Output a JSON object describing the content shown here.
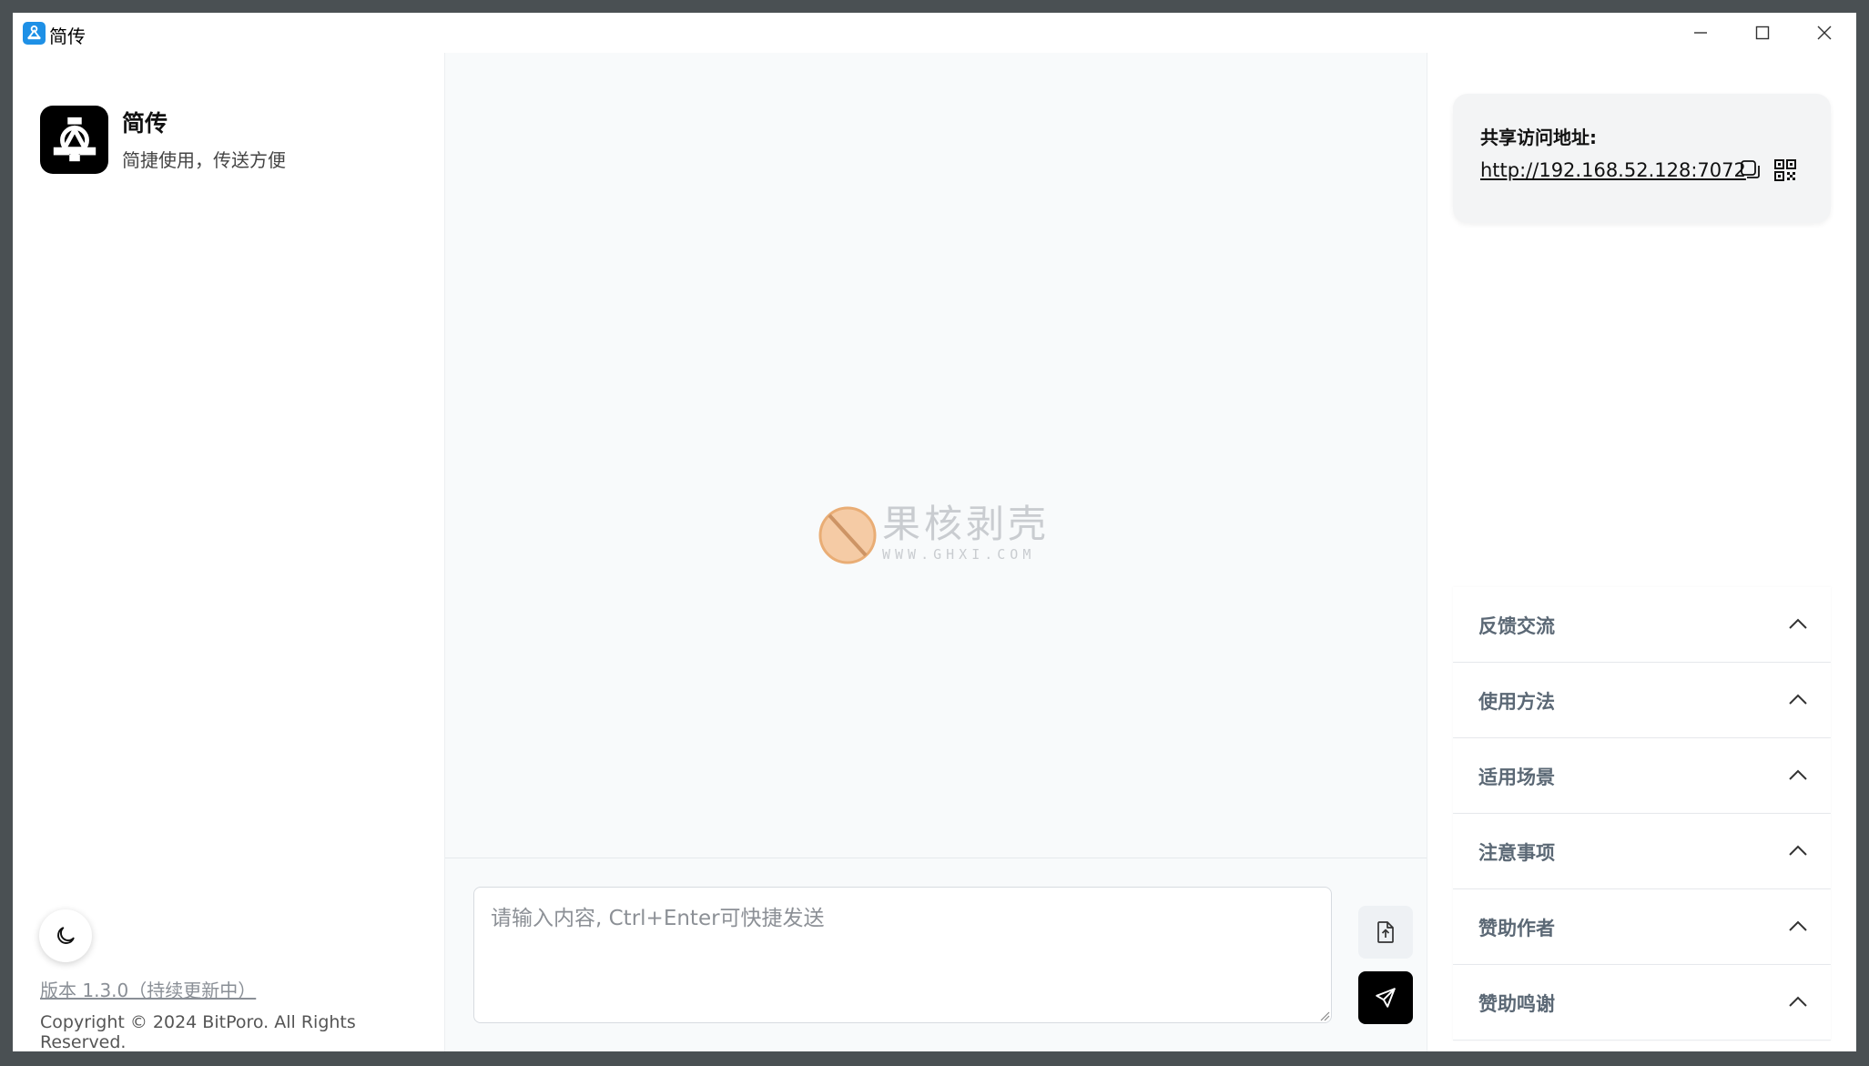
{
  "window": {
    "title": "简传",
    "controls": {
      "minimize_icon": "minimize-icon",
      "maximize_icon": "maximize-icon",
      "close_icon": "close-icon"
    }
  },
  "sidebar": {
    "brand_title": "简传",
    "brand_subtitle": "简捷使用，传送方便",
    "theme_toggle_icon": "moon-icon",
    "version": "版本 1.3.0（持续更新中）",
    "copyright": "Copyright © 2024 BitPoro. All Rights Reserved."
  },
  "center": {
    "watermark": {
      "title": "果核剥壳",
      "url": "WWW.GHXI.COM"
    },
    "composer": {
      "placeholder": "请输入内容, Ctrl+Enter可快捷发送",
      "value": "",
      "file_icon": "file-upload-icon",
      "send_icon": "send-icon"
    }
  },
  "right": {
    "share": {
      "label": "共享访问地址:",
      "url": "http://192.168.52.128:7072",
      "copy_icon": "copy-icon",
      "qr_icon": "qrcode-icon"
    },
    "accordion": [
      {
        "label": "反馈交流"
      },
      {
        "label": "使用方法"
      },
      {
        "label": "适用场景"
      },
      {
        "label": "注意事项"
      },
      {
        "label": "赞助作者"
      },
      {
        "label": "赞助鸣谢"
      }
    ]
  },
  "colors": {
    "accent": "#000000",
    "app_icon": "#1e90e6",
    "center_bg": "#f8fafb",
    "accordion_label": "#5b6875"
  }
}
